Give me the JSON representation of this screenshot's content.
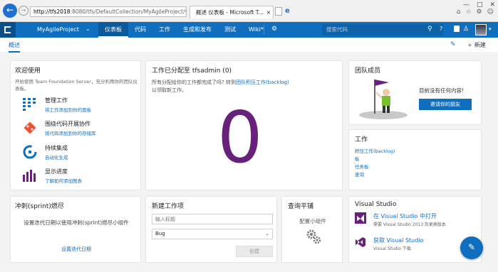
{
  "browser": {
    "address_host": "http://tfs2018",
    "address_path": ":8080/tfs/DefaultCollection/MyAgileProject/",
    "tab_title": "概述 仪表板 - Microsoft T..."
  },
  "topbar": {
    "project": "MyAgileProject",
    "nav": [
      "仪表板",
      "代码",
      "工作",
      "生成和发布",
      "测试",
      "Wiki*"
    ],
    "search_placeholder": "搜索代码"
  },
  "subbar": {
    "tab": "概述",
    "new_label": "新建"
  },
  "welcome": {
    "title": "欢迎使用",
    "desc": "开始使用 Team Foundation Server，充分利用你的团队仪表板。",
    "items": [
      {
        "title": "管理工作",
        "link": "将工作添加到你的面板"
      },
      {
        "title": "围绕代码开展协作",
        "link": "将代码添加到你的存储库"
      },
      {
        "title": "持续集成",
        "link": "自动化生成"
      },
      {
        "title": "显示进度",
        "link": "了解如何添加图表"
      }
    ]
  },
  "assigned": {
    "title": "工作已分配至 tfsadmin (0)",
    "desc_before": "所有分配给你的工作都完成了吗? 转到",
    "desc_link": "团队积压工作(backlog)",
    "desc_after": "以领取新工作。",
    "count": "0"
  },
  "team": {
    "title": "团队成员",
    "none": "目前没有任何内容!",
    "invite": "邀请你的朋友"
  },
  "work": {
    "title": "工作",
    "links": [
      "积压工作(backlog)",
      "板",
      "任务板",
      "查询"
    ]
  },
  "sprint": {
    "title": "冲刺(sprint)燃尽",
    "msg": "设置迭代日期以使用冲刺(sprint)燃尽小组件",
    "link": "设置迭代日期"
  },
  "newitem": {
    "title": "新建工作项",
    "input_placeholder": "输入标题",
    "type": "Bug",
    "create": "创建"
  },
  "query": {
    "title": "查询平铺",
    "cfg": "配置小组件"
  },
  "vs": {
    "title": "Visual Studio",
    "rows": [
      {
        "title": "在 Visual Studio 中打开",
        "sub": "需要 Visual Studio 2013 及更高版本"
      },
      {
        "title": "获取 Visual Studio",
        "sub": "Visual Studio 下载"
      }
    ]
  }
}
